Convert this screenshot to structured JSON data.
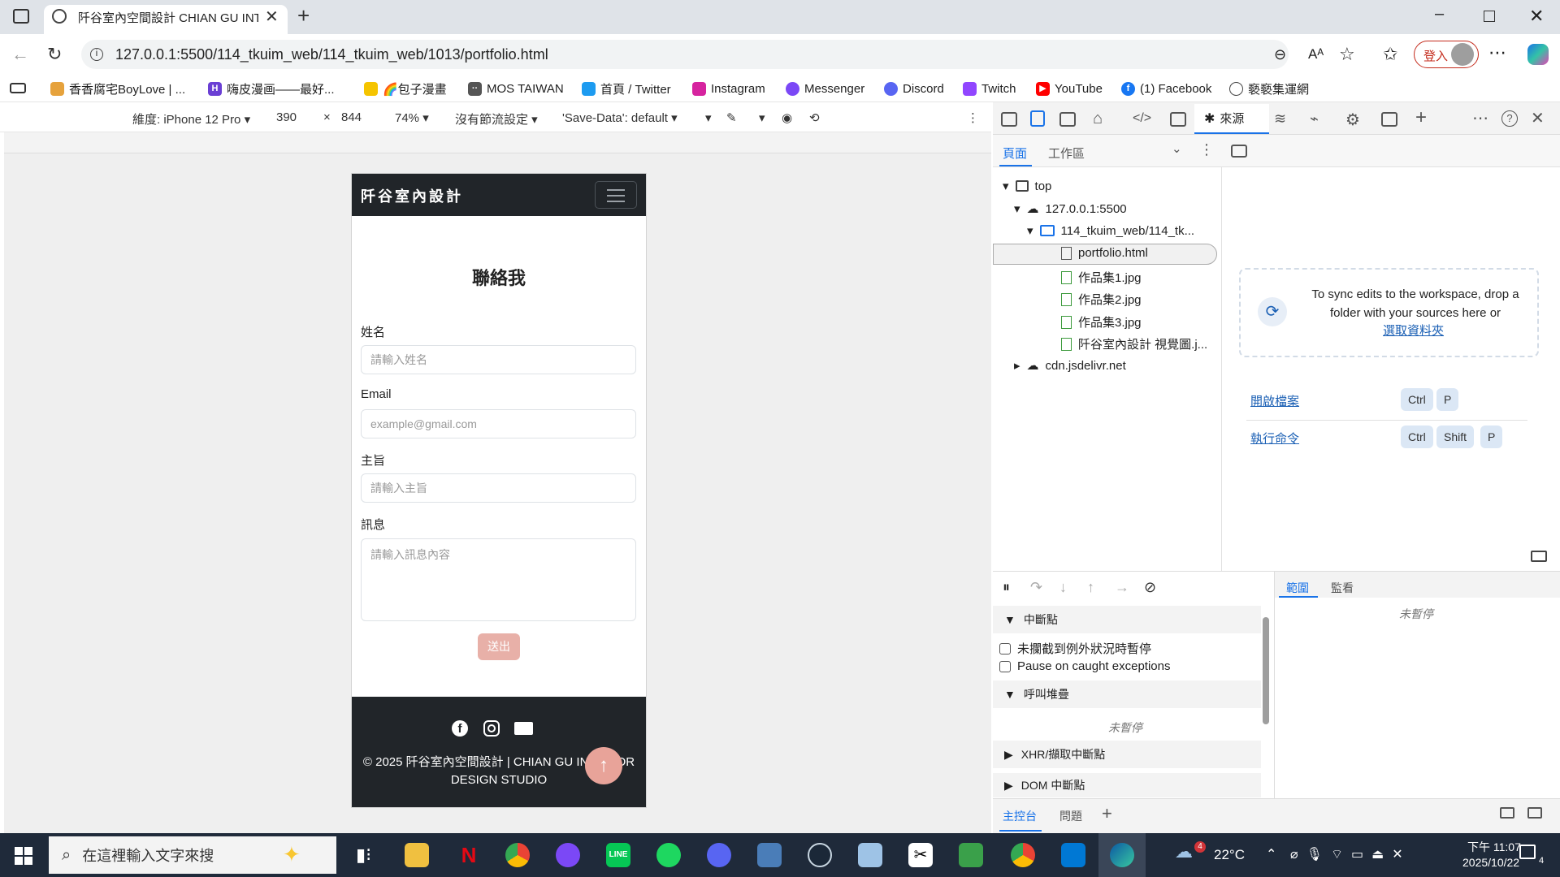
{
  "browser": {
    "tab_title": "阡谷室內空間設計 CHIAN GU INT",
    "url": "127.0.0.1:5500/114_tkuim_web/114_tkuim_web/1013/portfolio.html",
    "signin_label": "登入",
    "favorites": [
      {
        "label": "香香腐宅BoyLove | ...",
        "color": "#e6a23c"
      },
      {
        "label": "嗨皮漫画——最好...",
        "color": "#6a3fd4"
      },
      {
        "label": "🌈包子漫畫",
        "color": "#f5c400"
      },
      {
        "label": "MOS TAIWAN",
        "color": "#555555"
      },
      {
        "label": "首頁 / Twitter",
        "color": "#1d9bf0"
      },
      {
        "label": "Instagram",
        "color": "#d6249f"
      },
      {
        "label": "Messenger",
        "color": "#7b48f6"
      },
      {
        "label": "Discord",
        "color": "#5865f2"
      },
      {
        "label": "Twitch",
        "color": "#9146ff"
      },
      {
        "label": "YouTube",
        "color": "#ff0000"
      },
      {
        "label": "(1) Facebook",
        "color": "#1877f2"
      },
      {
        "label": "褻褻集運網",
        "color": "#444444"
      }
    ]
  },
  "emulation": {
    "device": "維度: iPhone 12 Pro",
    "width": "390",
    "times": "×",
    "height": "844",
    "zoom": "74%",
    "throttle": "沒有節流設定",
    "save_data": "'Save-Data': default"
  },
  "page": {
    "brand": "阡谷室內設計",
    "title": "聯絡我",
    "fields": {
      "name_label": "姓名",
      "name_placeholder": "請輸入姓名",
      "email_label": "Email",
      "email_placeholder": "example@gmail.com",
      "subject_label": "主旨",
      "subject_placeholder": "請輸入主旨",
      "message_label": "訊息",
      "message_placeholder": "請輸入訊息內容"
    },
    "send_label": "送出",
    "footer_copyright": "© 2025 阡谷室內空間設計 | CHIAN GU INTERIOR DESIGN STUDIO"
  },
  "devtools": {
    "sources_tab": "來源",
    "subtabs": {
      "page": "頁面",
      "workspace": "工作區"
    },
    "tree": {
      "top": "top",
      "host": "127.0.0.1:5500",
      "folder": "114_tkuim_web/114_tk...",
      "files": [
        "portfolio.html",
        "作品集1.jpg",
        "作品集2.jpg",
        "作品集3.jpg",
        "阡谷室內設計 視覺圖.j..."
      ],
      "cdn": "cdn.jsdelivr.net"
    },
    "sync_text": "To sync edits to the workspace, drop a folder with your sources here or",
    "select_folder": "選取資料夾",
    "open_file": "開啟檔案",
    "run_command": "執行命令",
    "keys": {
      "ctrl": "Ctrl",
      "shift": "Shift",
      "p": "P"
    },
    "debugger": {
      "breakpoints": "中斷點",
      "pause_uncaught": "未攔截到例外狀況時暫停",
      "pause_caught": "Pause on caught exceptions",
      "call_stack": "呼叫堆疊",
      "not_paused": "未暫停",
      "xhr": "XHR/擷取中斷點",
      "dom": "DOM 中斷點",
      "scope": "範圍",
      "watch": "監看"
    },
    "drawer": {
      "console": "主控台",
      "issues": "問題"
    }
  },
  "taskbar": {
    "search_placeholder": "在這裡輸入文字來搜",
    "temperature": "22°C",
    "time": "下午 11:07",
    "date": "2025/10/22",
    "weather_badge": "4",
    "notif_count": "4"
  }
}
